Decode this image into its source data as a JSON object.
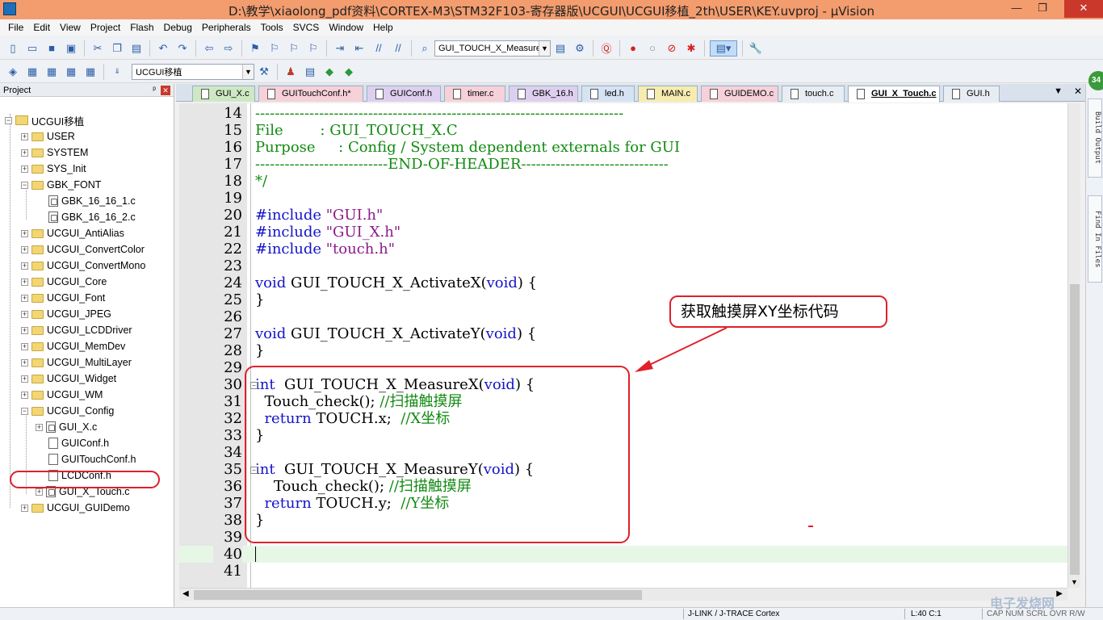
{
  "window": {
    "title": "D:\\教学\\xiaolong_pdf资料\\CORTEX-M3\\STM32F103-寄存器版\\UCGUI\\UCGUI移植_2th\\USER\\KEY.uvproj - µVision",
    "min": "—",
    "max": "❐",
    "close": "✕"
  },
  "menu": [
    "File",
    "Edit",
    "View",
    "Project",
    "Flash",
    "Debug",
    "Peripherals",
    "Tools",
    "SVCS",
    "Window",
    "Help"
  ],
  "toolbar1": {
    "find_combo": "GUI_TOUCH_X_MeasureY"
  },
  "toolbar2": {
    "target_combo": "UCGUI移植"
  },
  "project": {
    "header": "Project",
    "pin": "ᵖ",
    "close": "✕",
    "root": "UCGUI移植",
    "groups": [
      "USER",
      "SYSTEM",
      "SYS_Init",
      "GBK_FONT",
      "GBK_16_16_1.c",
      "GBK_16_16_2.c",
      "UCGUI_AntiAlias",
      "UCGUI_ConvertColor",
      "UCGUI_ConvertMono",
      "UCGUI_Core",
      "UCGUI_Font",
      "UCGUI_JPEG",
      "UCGUI_LCDDriver",
      "UCGUI_MemDev",
      "UCGUI_MultiLayer",
      "UCGUI_Widget",
      "UCGUI_WM",
      "UCGUI_Config",
      "GUI_X.c",
      "GUIConf.h",
      "GUITouchConf.h",
      "LCDConf.h",
      "GUI_X_Touch.c",
      "UCGUI_GUIDemo"
    ]
  },
  "tabs": [
    "GUI_X.c",
    "GUITouchConf.h*",
    "GUIConf.h",
    "timer.c",
    "GBK_16.h",
    "led.h",
    "MAIN.c",
    "GUIDEMO.c",
    "touch.c",
    "GUI_X_Touch.c",
    "GUI.h"
  ],
  "tab_controls": {
    "menu": "▼",
    "close": "✕"
  },
  "code": {
    "numbers": [
      "14",
      "15",
      "16",
      "17",
      "18",
      "19",
      "20",
      "21",
      "22",
      "23",
      "24",
      "25",
      "26",
      "27",
      "28",
      "29",
      "30",
      "31",
      "32",
      "33",
      "34",
      "35",
      "36",
      "37",
      "38",
      "39",
      "40",
      "41"
    ],
    "l14": "---------------------------------------------------------------------------",
    "l15": "File        : GUI_TOUCH_X.C",
    "l16": "Purpose     : Config / System dependent externals for GUI",
    "l17": "---------------------------END-OF-HEADER------------------------------",
    "l18": "*/",
    "l20a": "#include ",
    "l20b": "\"GUI.h\"",
    "l21a": "#include ",
    "l21b": "\"GUI_X.h\"",
    "l22a": "#include ",
    "l22b": "\"touch.h\"",
    "l24a": "void",
    "l24b": " GUI_TOUCH_X_ActivateX(",
    "l24c": "void",
    "l24d": ") {",
    "l25": "}",
    "l27a": "void",
    "l27b": " GUI_TOUCH_X_ActivateY(",
    "l27c": "void",
    "l27d": ") {",
    "l28": "}",
    "l30a": "int",
    "l30b": "  GUI_TOUCH_X_MeasureX(",
    "l30c": "void",
    "l30d": ") {",
    "l31a": "  Touch_check(); ",
    "l31b": "//扫描触摸屏",
    "l32a": "  return",
    "l32b": " TOUCH.x;  ",
    "l32c": "//X坐标",
    "l33": "}",
    "l35a": "int",
    "l35b": "  GUI_TOUCH_X_MeasureY(",
    "l35c": "void",
    "l35d": ") {",
    "l36a": "    Touch_check(); ",
    "l36b": "//扫描触摸屏",
    "l37a": "  return",
    "l37b": " TOUCH.y;  ",
    "l37c": "//Y坐标",
    "l38": "}"
  },
  "annotation": {
    "callout": "获取触摸屏XY坐标代码"
  },
  "right_panel": {
    "badge": "34",
    "build_output": "Build Output",
    "find_in_files": "Find In Files"
  },
  "status": {
    "debugger": "J-LINK / J-TRACE Cortex",
    "position": "L:40 C:1",
    "flags": "CAP  NUM  SCRL  OVR  R/W"
  },
  "watermark": "电子发烧网",
  "colors": {
    "titlebar": "#f39c6e",
    "comment": "#118a11",
    "keyword": "#1414c8",
    "string": "#8a1a8a",
    "annotation_red": "#e0202a"
  }
}
